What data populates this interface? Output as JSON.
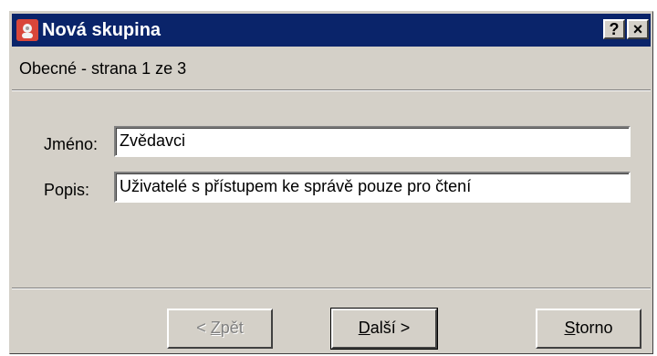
{
  "window": {
    "title": "Nová skupina",
    "help_label": "?",
    "close_label": "×"
  },
  "page": {
    "heading": "Obecné - strana 1 ze 3"
  },
  "form": {
    "name_label": "Jméno:",
    "name_value": "Zvědavci",
    "description_label": "Popis:",
    "description_value": "Uživatelé s přístupem ke správě pouze pro čtení"
  },
  "buttons": {
    "back_pre": "< ",
    "back_ul": "Z",
    "back_post": "pět",
    "next_ul": "D",
    "next_post": "alší >",
    "cancel_ul": "S",
    "cancel_post": "torno"
  },
  "icons": {
    "app_icon": "group-admin-icon",
    "help_icon": "help-icon",
    "close_icon": "close-icon"
  },
  "colors": {
    "titlebar": "#0a246a",
    "dialog": "#d4d0c8"
  }
}
